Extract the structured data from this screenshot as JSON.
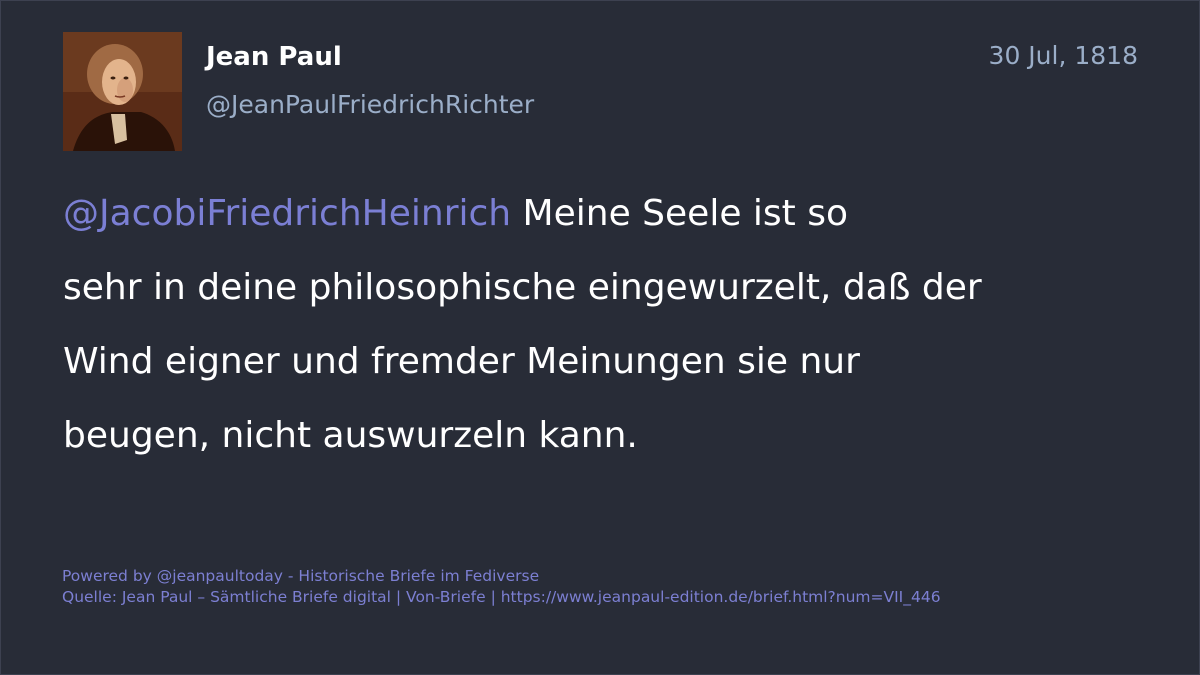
{
  "author": {
    "display_name": "Jean Paul",
    "handle": "@JeanPaulFriedrichRichter",
    "avatar_icon": "portrait-avatar"
  },
  "post": {
    "date": "30 Jul, 1818",
    "mention": "@JacobiFriedrichHeinrich",
    "text_line_1": " Meine Seele ist so",
    "text_line_2": "sehr in deine philosophische eingewurzelt, daß der",
    "text_line_3": "Wind eigner und fremder Meinungen sie nur",
    "text_line_4": "beugen, nicht auswurzeln kann."
  },
  "footer": {
    "powered_by": "Powered by @jeanpaultoday - Historische Briefe im Fediverse",
    "source": "Quelle: Jean Paul – Sämtliche Briefe digital | Von-Briefe | https://www.jeanpaul-edition.de/brief.html?num=VII_446"
  },
  "colors": {
    "background": "#282c37",
    "text": "#ffffff",
    "secondary_text": "#9baec8",
    "mention": "#7b7fd4",
    "footer_text": "#7c7fd2"
  }
}
